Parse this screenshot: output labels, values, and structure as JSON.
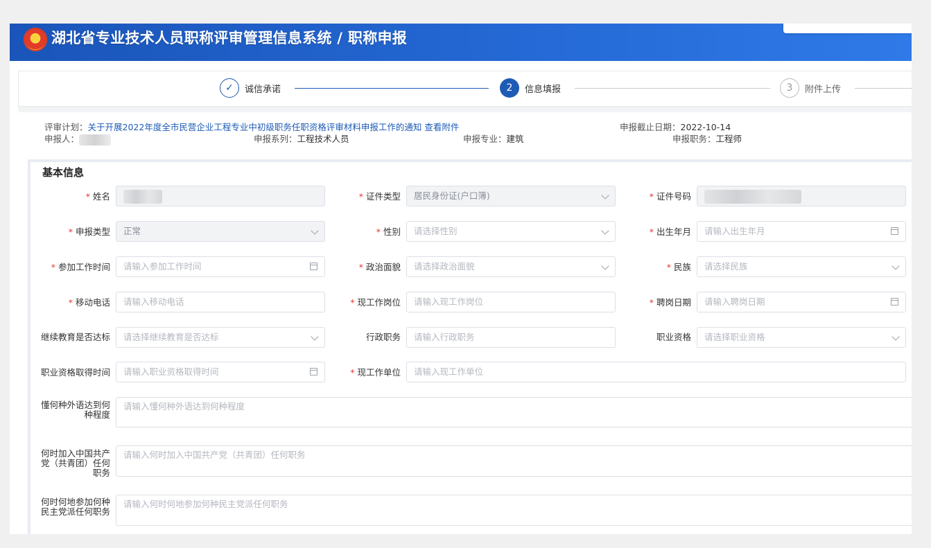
{
  "header": {
    "title": "湖北省专业技术人员职称评审管理信息系统 / 职称申报"
  },
  "steps": [
    {
      "num": "✓",
      "label": "诚信承诺",
      "state": "done"
    },
    {
      "num": "2",
      "label": "信息填报",
      "state": "active"
    },
    {
      "num": "3",
      "label": "附件上传",
      "state": "wait"
    }
  ],
  "info": {
    "plan_label": "评审计划：",
    "plan_link": "关于开展2022年度全市民营企业工程专业中初级职务任职资格评审材料申报工作的通知",
    "plan_attach": "查看附件",
    "deadline_label": "申报截止日期：",
    "deadline": "2022-10-14",
    "applicant_label": "申报人：",
    "series_label": "申报系列：",
    "series": "工程技术人员",
    "major_label": "申报专业：",
    "major": "建筑",
    "position_label": "申报职务：",
    "position": "工程师"
  },
  "form": {
    "section_title": "基本信息",
    "name": {
      "label": "姓名"
    },
    "id_type": {
      "label": "证件类型",
      "value": "居民身份证(户口簿)"
    },
    "id_number": {
      "label": "证件号码"
    },
    "apply_type": {
      "label": "申报类型",
      "value": "正常"
    },
    "gender": {
      "label": "性别",
      "placeholder": "请选择性别"
    },
    "birth": {
      "label": "出生年月",
      "placeholder": "请输入出生年月"
    },
    "work_start": {
      "label": "参加工作时间",
      "placeholder": "请输入参加工作时间"
    },
    "political": {
      "label": "政治面貌",
      "placeholder": "请选择政治面貌"
    },
    "ethnic": {
      "label": "民族",
      "placeholder": "请选择民族"
    },
    "mobile": {
      "label": "移动电话",
      "placeholder": "请输入移动电话"
    },
    "post": {
      "label": "现工作岗位",
      "placeholder": "请输入现工作岗位"
    },
    "hire_date": {
      "label": "聘岗日期",
      "placeholder": "请输入聘岗日期"
    },
    "edu": {
      "label": "继续教育是否达标",
      "placeholder": "请选择继续教育是否达标"
    },
    "admin_duty": {
      "label": "行政职务",
      "placeholder": "请输入行政职务"
    },
    "qualification": {
      "label": "职业资格",
      "placeholder": "请选择职业资格"
    },
    "qual_time": {
      "label": "职业资格取得时间",
      "placeholder": "请输入职业资格取得时间"
    },
    "employer": {
      "label": "现工作单位",
      "placeholder": "请输入现工作单位"
    },
    "language": {
      "label": "懂何种外语达到何种程度",
      "placeholder": "请输入懂何种外语达到何种程度"
    },
    "party": {
      "label": "何时加入中国共产党（共青团）任何职务",
      "placeholder": "请输入何时加入中国共产党（共青团）任何职务"
    },
    "democratic": {
      "label": "何时何地参加何种民主党派任何职务",
      "placeholder": "请输入何时何地参加何种民主党派任何职务"
    }
  }
}
